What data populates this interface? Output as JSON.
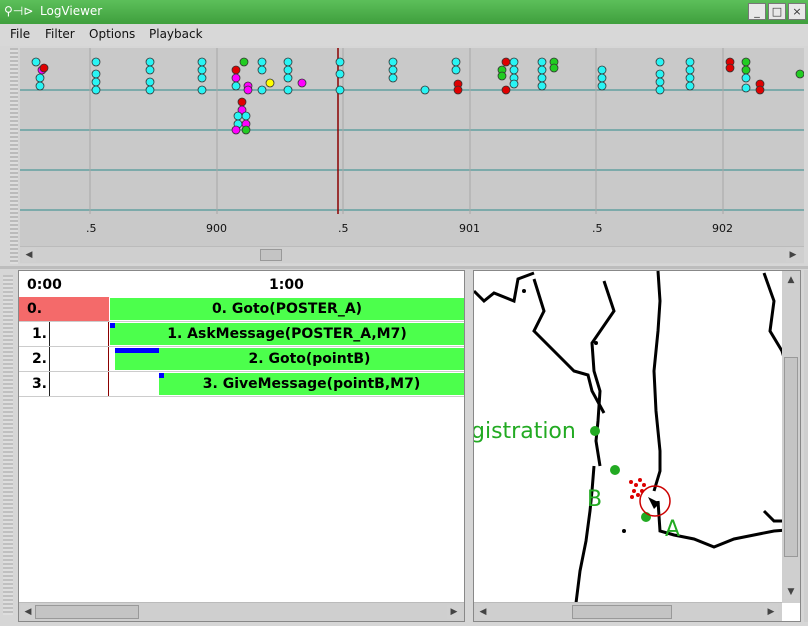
{
  "window": {
    "title": "LogViewer",
    "buttons": [
      "_",
      "□",
      "×"
    ]
  },
  "menu": [
    "File",
    "Filter",
    "Options",
    "Playback"
  ],
  "timeline": {
    "tick_labels": [
      ".5",
      "900",
      ".5",
      "901",
      ".5",
      "902"
    ]
  },
  "tasks": {
    "time_start": "0:00",
    "time_mid": "1:00",
    "rows": [
      {
        "index": "0.",
        "label": "0. Goto(POSTER_A)"
      },
      {
        "index": "1.",
        "label": "1. AskMessage(POSTER_A,M7)"
      },
      {
        "index": "2.",
        "label": "2. Goto(pointB)"
      },
      {
        "index": "3.",
        "label": "3. GiveMessage(pointB,M7)"
      }
    ]
  },
  "map": {
    "labels": [
      "gistration",
      "B",
      "A"
    ]
  },
  "colors": {
    "accent_green": "#4cff4c",
    "active_row": "#f46a6a",
    "marker_red": "#cc0000"
  }
}
